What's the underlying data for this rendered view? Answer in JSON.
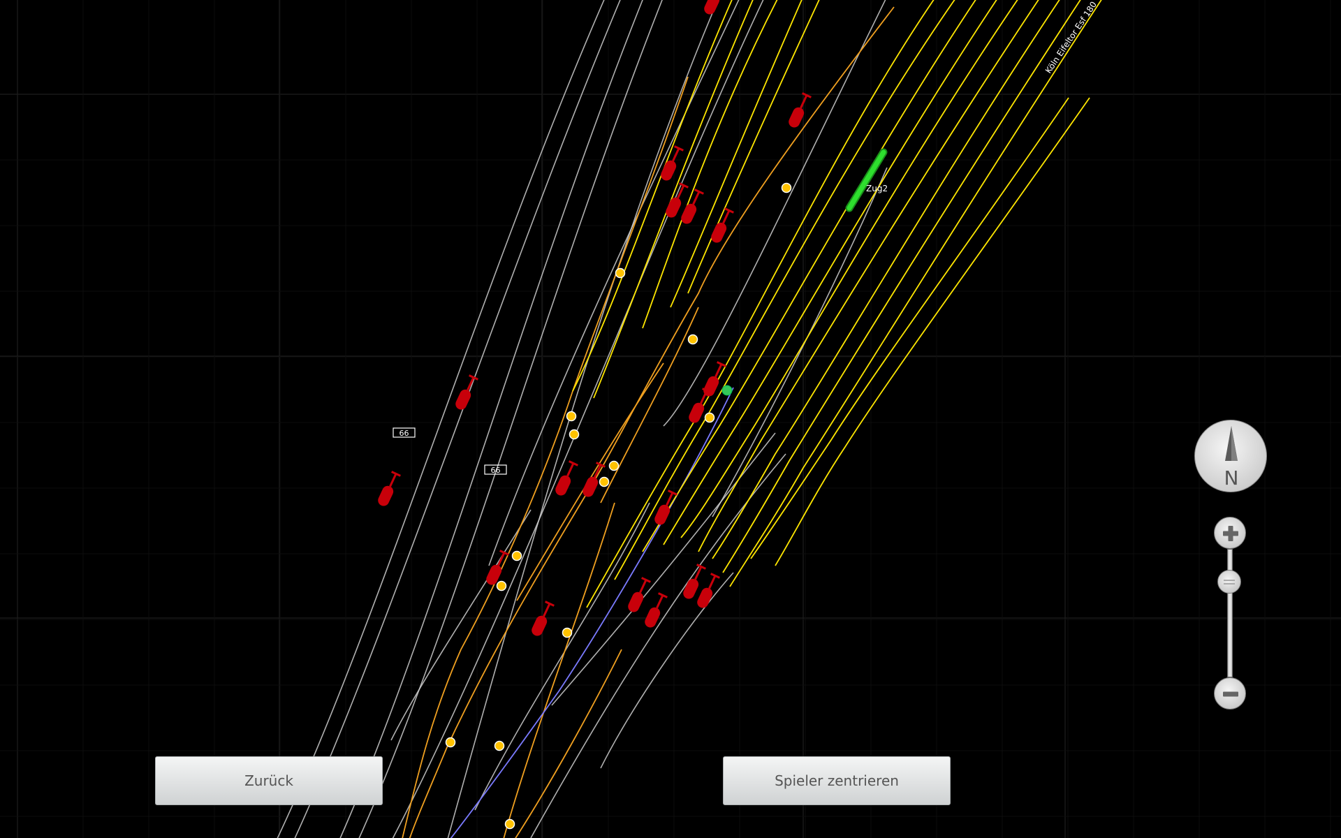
{
  "buttons": {
    "back": "Zurück",
    "center_player": "Spieler zentrieren"
  },
  "compass": {
    "label": "N"
  },
  "map": {
    "train_label": "Zug2",
    "station_label": "Köln Eifeltor Esf 180",
    "track_markers": [
      "66",
      "66"
    ]
  },
  "colors": {
    "background": "#000000",
    "grid": "#1e1e1e",
    "track_white": "#cfcfcf",
    "track_yellow": "#ffe600",
    "track_orange": "#f0a020",
    "track_blue": "#7a7aff",
    "signal_red": "#c8000a",
    "switch_point": "#ffc200",
    "train": "#22cc22"
  }
}
